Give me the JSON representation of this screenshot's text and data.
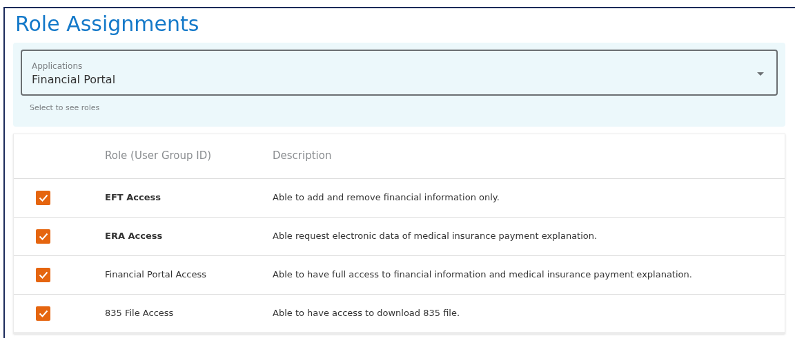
{
  "title": "Role Assignments",
  "applications_select": {
    "label": "Applications",
    "value": "Financial Portal",
    "helper_text": "Select to see roles"
  },
  "table": {
    "columns": [
      "Role (User Group ID)",
      "Description"
    ],
    "rows": [
      {
        "checked": true,
        "role": "EFT Access",
        "bold": true,
        "description": "Able to add and remove financial information only."
      },
      {
        "checked": true,
        "role": "ERA Access",
        "bold": true,
        "description": "Able request electronic data of medical insurance payment explanation."
      },
      {
        "checked": true,
        "role": "Financial Portal Access",
        "bold": false,
        "description": "Able to have full access to financial information and medical insurance payment explanation."
      },
      {
        "checked": true,
        "role": "835 File Access",
        "bold": false,
        "description": "Able to have access to download 835 file."
      }
    ]
  }
}
